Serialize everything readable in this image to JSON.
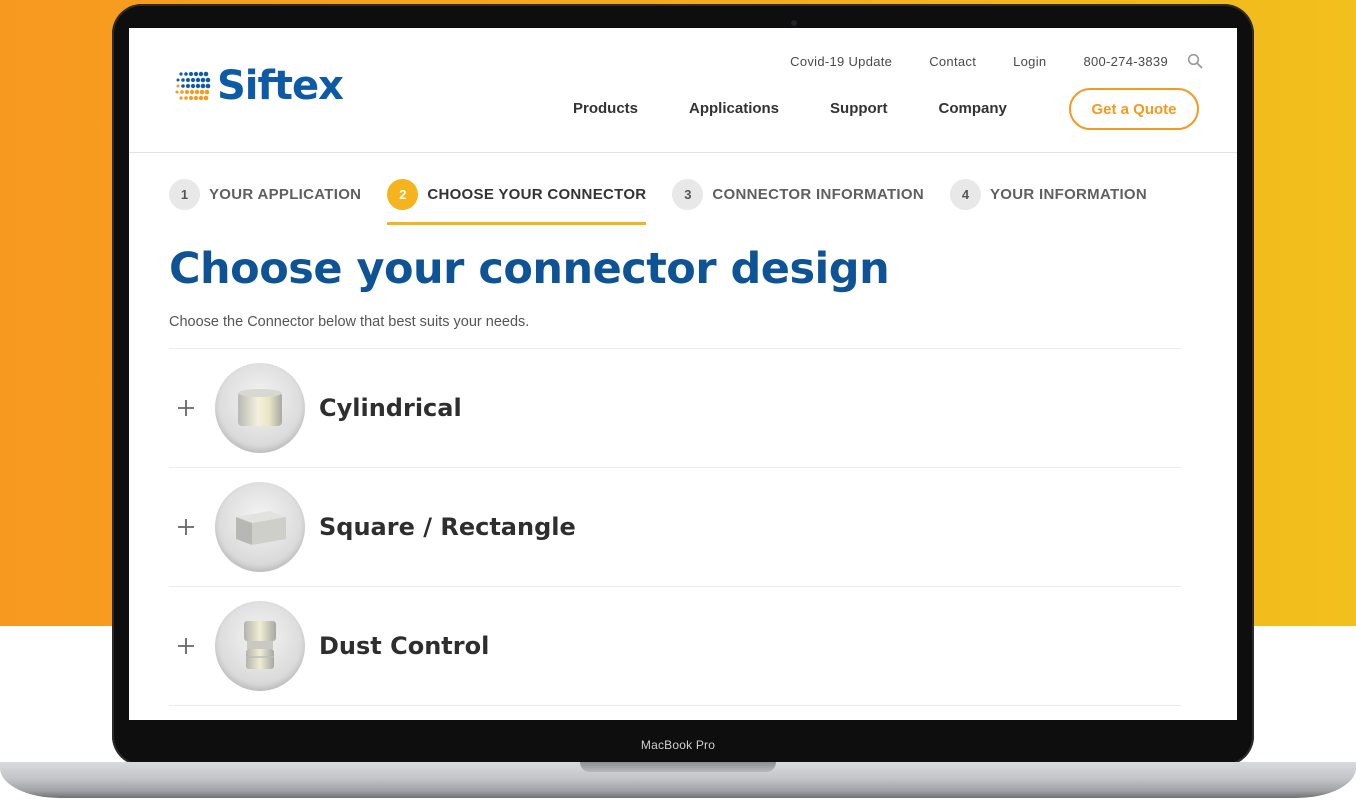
{
  "device": {
    "label": "MacBook Pro"
  },
  "brand": {
    "name": "Siftex",
    "accent": "#f39a1f",
    "primary": "#0d5aa7"
  },
  "utility_nav": {
    "covid": "Covid-19 Update",
    "contact": "Contact",
    "login": "Login",
    "phone": "800-274-3839",
    "search_icon": "search-icon"
  },
  "main_nav": {
    "products": "Products",
    "applications": "Applications",
    "support": "Support",
    "company": "Company"
  },
  "quote_button": "Get a Quote",
  "steps": [
    {
      "num": "1",
      "label": "YOUR APPLICATION",
      "active": false
    },
    {
      "num": "2",
      "label": "CHOOSE YOUR CONNECTOR",
      "active": true
    },
    {
      "num": "3",
      "label": "CONNECTOR INFORMATION",
      "active": false
    },
    {
      "num": "4",
      "label": "YOUR INFORMATION",
      "active": false
    }
  ],
  "page": {
    "title": "Choose your connector design",
    "intro": "Choose the Connector below that best suits your needs."
  },
  "options": [
    {
      "title": "Cylindrical",
      "icon": "cylindrical-connector-icon"
    },
    {
      "title": "Square / Rectangle",
      "icon": "square-connector-icon"
    },
    {
      "title": "Dust Control",
      "icon": "dust-control-connector-icon"
    }
  ]
}
